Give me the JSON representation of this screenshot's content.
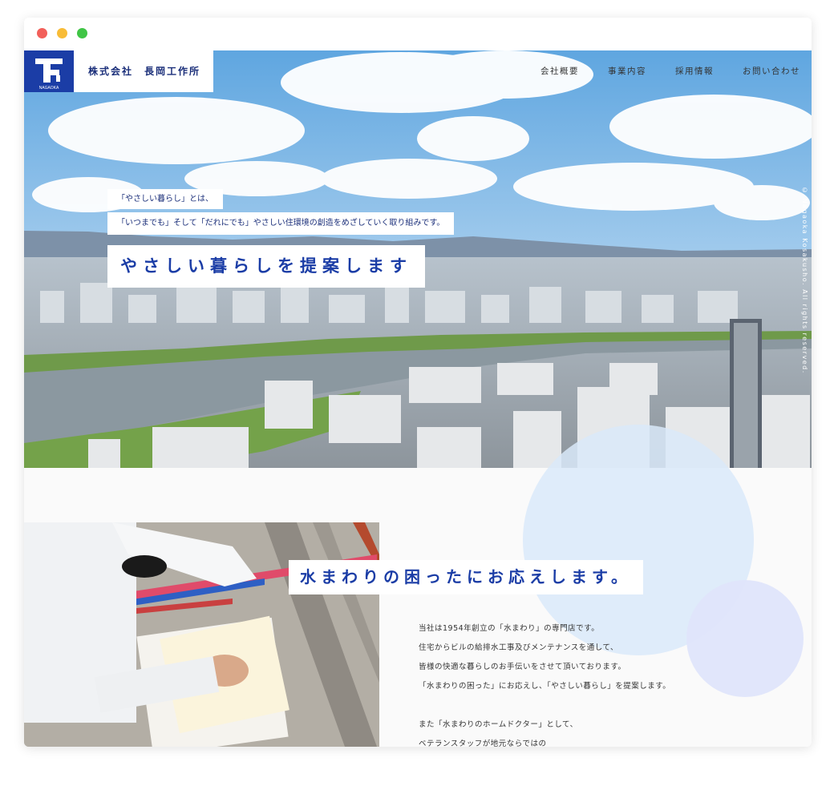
{
  "window_controls": [
    "close",
    "minimize",
    "zoom"
  ],
  "header": {
    "logo_text": "NAGAOKA",
    "company_name": "株式会社　長岡工作所",
    "nav": [
      "会社概要",
      "事業内容",
      "採用情報",
      "お問い合わせ"
    ]
  },
  "hero": {
    "tagline_1": "「やさしい暮らし」とは、",
    "tagline_2": "「いつまでも」そして「だれにでも」やさしい住環境の創造をめざしていく取り組みです。",
    "headline": "やさしい暮らしを提案します",
    "copyright": "© Nagaoka Kosakusho. All rights reserved."
  },
  "intro": {
    "heading": "水まわりの困ったにお応えします。",
    "paragraphs": [
      "当社は1954年創立の「水まわり」の専門店です。",
      "住宅からビルの給排水工事及びメンテナンスを通して、",
      "皆様の快適な暮らしのお手伝いをさせて頂いております。",
      "「水まわりの困った」にお応えし、「やさしい暮らし」を提案します。",
      "",
      "また「水まわりのホームドクター」として、",
      "ベテランスタッフが地元ならではの"
    ]
  },
  "colors": {
    "brand_blue": "#1b3da6",
    "text_navy": "#1b2f7a",
    "circle_light_blue": "#d9e9f9",
    "circle_lavender": "#dfe5fb"
  }
}
